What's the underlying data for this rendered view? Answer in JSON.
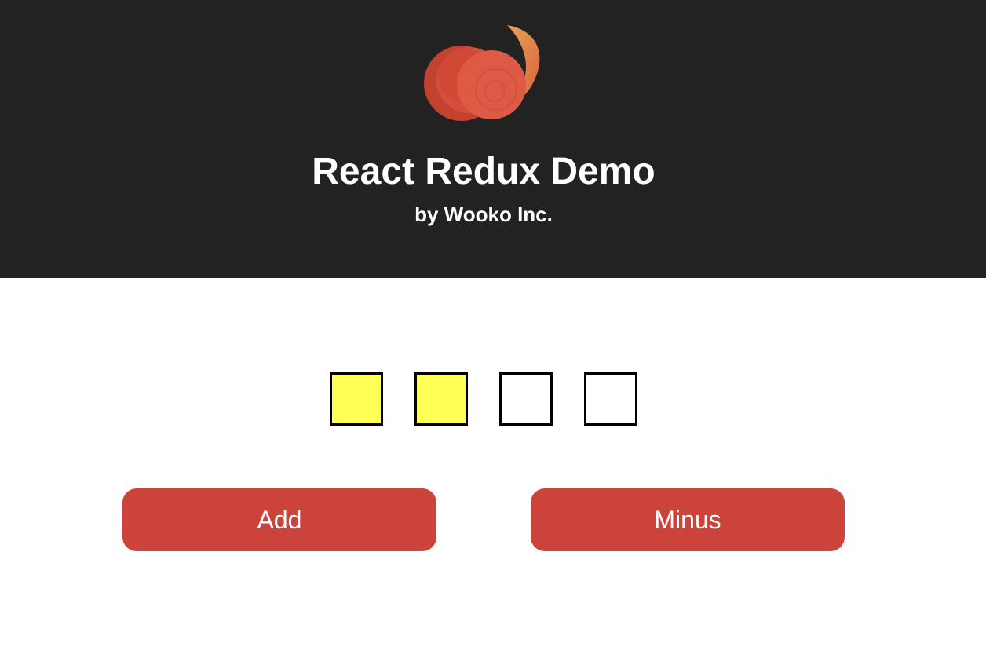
{
  "header": {
    "title": "React Redux Demo",
    "subtitle": "by Wooko Inc.",
    "logo_icon": "redux-swirl-logo-icon"
  },
  "counter": {
    "total": 4,
    "filled": 2,
    "filled_color": "#ffff55",
    "empty_color": "#ffffff"
  },
  "buttons": {
    "add_label": "Add",
    "minus_label": "Minus",
    "color": "#cc433b"
  },
  "colors": {
    "header_bg": "#222222",
    "page_bg": "#ffffff"
  }
}
